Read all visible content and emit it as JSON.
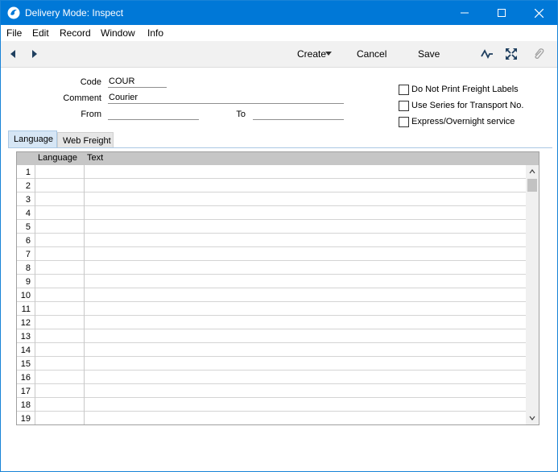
{
  "window": {
    "title": "Delivery Mode: Inspect"
  },
  "menu": [
    "File",
    "Edit",
    "Record",
    "Window",
    "Info"
  ],
  "toolbar": {
    "create_label": "Create",
    "cancel_label": "Cancel",
    "save_label": "Save"
  },
  "form": {
    "code_label": "Code",
    "code_value": "COUR",
    "comment_label": "Comment",
    "comment_value": "Courier",
    "from_label": "From",
    "from_value": "",
    "to_label": "To",
    "to_value": ""
  },
  "options": [
    {
      "label": "Do Not Print Freight Labels",
      "checked": false
    },
    {
      "label": "Use Series for Transport No.",
      "checked": false
    },
    {
      "label": "Express/Overnight service",
      "checked": false
    }
  ],
  "tabs": [
    {
      "label": "Language",
      "active": true
    },
    {
      "label": "Web Freight",
      "active": false
    }
  ],
  "grid": {
    "columns": [
      "Language",
      "Text"
    ],
    "row_numbers": [
      "1",
      "2",
      "3",
      "4",
      "5",
      "6",
      "7",
      "8",
      "9",
      "10",
      "11",
      "12",
      "13",
      "14",
      "15",
      "16",
      "17",
      "18",
      "19"
    ]
  }
}
